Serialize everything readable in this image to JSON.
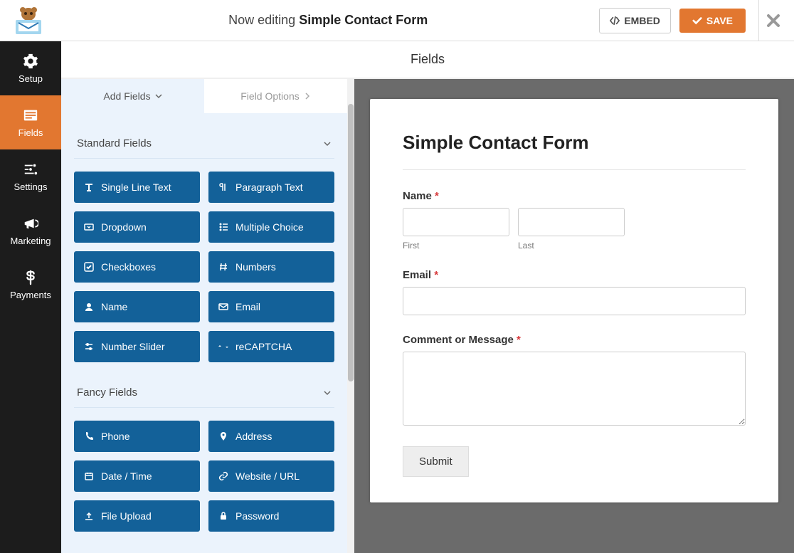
{
  "header": {
    "prefix": "Now editing ",
    "title": "Simple Contact Form",
    "embed": "EMBED",
    "save": "SAVE"
  },
  "nav": [
    {
      "id": "setup",
      "label": "Setup"
    },
    {
      "id": "fields",
      "label": "Fields"
    },
    {
      "id": "settings",
      "label": "Settings"
    },
    {
      "id": "marketing",
      "label": "Marketing"
    },
    {
      "id": "payments",
      "label": "Payments"
    }
  ],
  "content": {
    "heading": "Fields"
  },
  "tabs": {
    "add": "Add Fields",
    "options": "Field Options"
  },
  "sections": {
    "standard": {
      "title": "Standard Fields",
      "fields": [
        "Single Line Text",
        "Paragraph Text",
        "Dropdown",
        "Multiple Choice",
        "Checkboxes",
        "Numbers",
        "Name",
        "Email",
        "Number Slider",
        "reCAPTCHA"
      ]
    },
    "fancy": {
      "title": "Fancy Fields",
      "fields": [
        "Phone",
        "Address",
        "Date / Time",
        "Website / URL",
        "File Upload",
        "Password"
      ]
    }
  },
  "form": {
    "title": "Simple Contact Form",
    "name_label": "Name",
    "first": "First",
    "last": "Last",
    "email_label": "Email",
    "message_label": "Comment or Message",
    "submit": "Submit"
  }
}
